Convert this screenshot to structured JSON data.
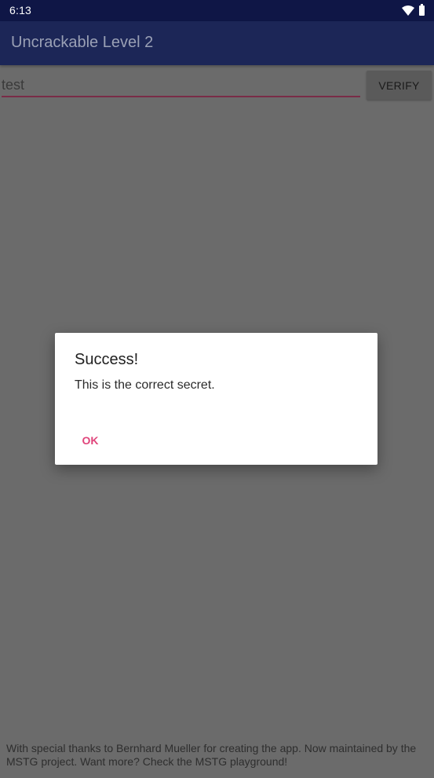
{
  "status_bar": {
    "time": "6:13",
    "icons": [
      "wifi-icon",
      "battery-icon"
    ]
  },
  "app_bar": {
    "title": "Uncrackable Level 2"
  },
  "main": {
    "secret_input_value": "test",
    "verify_label": "VERIFY",
    "footer": "With special thanks to Bernhard Mueller for creating the app. Now maintained by the MSTG project. Want more? Check the MSTG playground!"
  },
  "dialog": {
    "title": "Success!",
    "message": "This is the correct secret.",
    "ok_label": "OK"
  },
  "colors": {
    "status_bar": "#0f1646",
    "app_bar": "#1c2657",
    "accent": "#e0457b",
    "scrim_background": "#6b6b6b"
  }
}
